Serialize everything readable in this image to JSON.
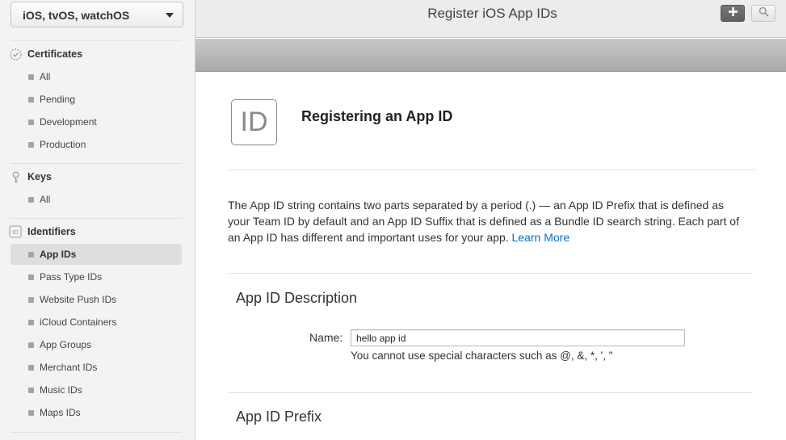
{
  "sidebar": {
    "platform": "iOS, tvOS, watchOS",
    "sections": [
      {
        "title": "Certificates",
        "icon": "certificate-icon",
        "items": [
          "All",
          "Pending",
          "Development",
          "Production"
        ]
      },
      {
        "title": "Keys",
        "icon": "key-icon",
        "items": [
          "All"
        ]
      },
      {
        "title": "Identifiers",
        "icon": "id-icon",
        "items": [
          "App IDs",
          "Pass Type IDs",
          "Website Push IDs",
          "iCloud Containers",
          "App Groups",
          "Merchant IDs",
          "Music IDs",
          "Maps IDs"
        ]
      }
    ],
    "active_item": "App IDs"
  },
  "header": {
    "title": "Register iOS App IDs",
    "add_icon": "plus-icon",
    "search_icon": "search-icon"
  },
  "main": {
    "icon_text": "ID",
    "heading": "Registering an App ID",
    "description": "The App ID string contains two parts separated by a period (.) — an App ID Prefix that is defined as your Team ID by default and an App ID Suffix that is defined as a Bundle ID search string. Each part of an App ID has different and important uses for your app.",
    "learn_more": "Learn More",
    "description_section": {
      "title": "App ID Description",
      "name_label": "Name:",
      "name_value": "hello app id",
      "hint": "You cannot use special characters such as @, &, *, ', \""
    },
    "prefix_section": {
      "title": "App ID Prefix"
    }
  },
  "colors": {
    "link": "#0070c9",
    "sidebar_bg": "#f3f3f3",
    "active_item_bg": "#dedede"
  }
}
